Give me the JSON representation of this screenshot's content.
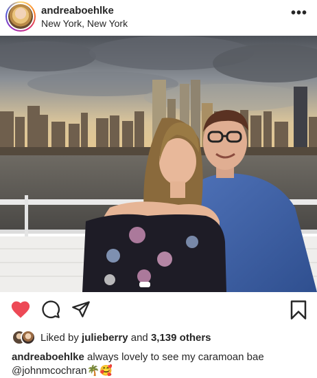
{
  "post": {
    "username": "andreaboehlke",
    "location": "New York, New York",
    "more_label": "•••"
  },
  "likes": {
    "prefix": "Liked by",
    "first_liker": "julieberry",
    "and_text": "and",
    "others_text": "3,139 others"
  },
  "caption": {
    "username": "andreaboehlke",
    "text": "always lovely to see my caramoan bae",
    "mention": "@johnmcochran",
    "emojis": "🌴🥰"
  },
  "colors": {
    "like_red": "#ed4956",
    "text": "#262626"
  },
  "icons": [
    "heart-icon",
    "comment-icon",
    "share-icon",
    "bookmark-icon",
    "more-icon"
  ]
}
